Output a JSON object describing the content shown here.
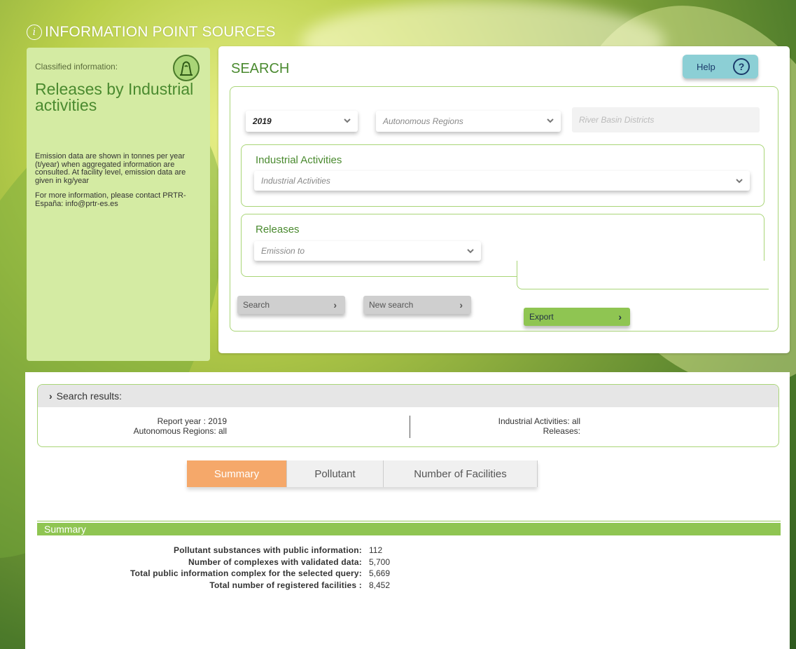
{
  "page_title": "INFORMATION POINT SOURCES",
  "sidebar": {
    "classified_label": "Classified information:",
    "title": "Releases by Industrial activities",
    "note_emission": "Emission data are shown in tonnes per year (t/year) when aggregated information are consulted. At facility level, emission data are given in kg/year",
    "note_contact": "For more information, please contact PRTR-España: info@prtr-es.es"
  },
  "search": {
    "title": "SEARCH",
    "help_label": "Help",
    "year_value": "2019",
    "regions_placeholder": "Autonomous Regions",
    "basin_placeholder": "River Basin Districts",
    "industrial_title": "Industrial Activities",
    "industrial_placeholder": "Industrial Activities",
    "releases_title": "Releases",
    "releases_placeholder": "Emission to",
    "search_button": "Search",
    "new_search_button": "New search",
    "export_button": "Export"
  },
  "results": {
    "header": "Search results:",
    "report_year": "Report year : 2019",
    "autonomous_regions": "Autonomous Regions: all",
    "industrial_activities": "Industrial Activities: all",
    "releases": "Releases:"
  },
  "tabs": [
    {
      "label": "Summary",
      "active": true
    },
    {
      "label": "Pollutant",
      "active": false
    },
    {
      "label": "Number of Facilities",
      "active": false
    }
  ],
  "summary": {
    "title": "Summary",
    "rows": [
      {
        "label": "Pollutant substances with public information:",
        "value": "112"
      },
      {
        "label": "Number of complexes with validated data:",
        "value": "5,700"
      },
      {
        "label": "Total public information complex for the selected query:",
        "value": "5,669"
      },
      {
        "label": "Total number of registered facilities :",
        "value": "8,452"
      }
    ]
  },
  "colors": {
    "accent_green": "#4a8a2f",
    "light_green": "#d4eba3",
    "border_green": "#a9d577",
    "active_tab": "#f5a86a",
    "help_button": "#8ccfd5"
  }
}
